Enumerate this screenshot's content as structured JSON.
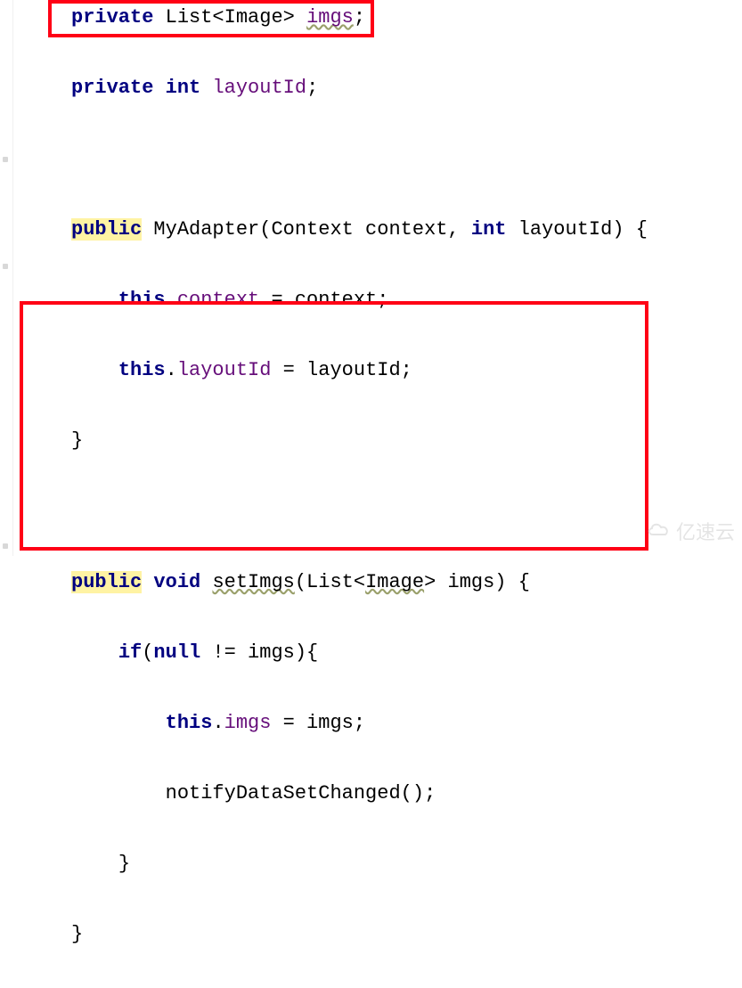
{
  "code": {
    "l1_kw": "private",
    "l1_type_open": " List<",
    "l1_type_inner": "Image",
    "l1_type_close": "> ",
    "l1_var": "imgs",
    "l1_end": ";",
    "l2_kw": "private int ",
    "l2_var": "layoutId",
    "l2_end": ";",
    "l3_kw1": "public",
    "l3_name": " MyAdapter(Context context, ",
    "l3_kw2": "int",
    "l3_rest": " layoutId) {",
    "l4a": "    ",
    "l4_kw": "this",
    "l4_dot": ".",
    "l4_fld": "context",
    "l4_rest": " = context;",
    "l5a": "    ",
    "l5_kw": "this",
    "l5_dot": ".",
    "l5_fld": "layoutId",
    "l5_rest": " = layoutId;",
    "l6": "}",
    "l7_kw1": "public",
    "l7_sp1": " ",
    "l7_kw2": "void",
    "l7_sp2": " ",
    "l7_name": "setImgs",
    "l7_paren": "(List<",
    "l7_type": "Image",
    "l7_rest": "> imgs) {",
    "l8a": "    ",
    "l8_kw1": "if",
    "l8_open": "(",
    "l8_kw2": "null",
    "l8_rest": " != imgs){",
    "l9a": "        ",
    "l9_kw": "this",
    "l9_dot": ".",
    "l9_fld": "imgs",
    "l9_rest": " = imgs;",
    "l10a": "        ",
    "l10": "notifyDataSetChanged();",
    "l11a": "    ",
    "l11": "}",
    "l12": "}"
  },
  "watermark": {
    "text": "亿速云"
  }
}
